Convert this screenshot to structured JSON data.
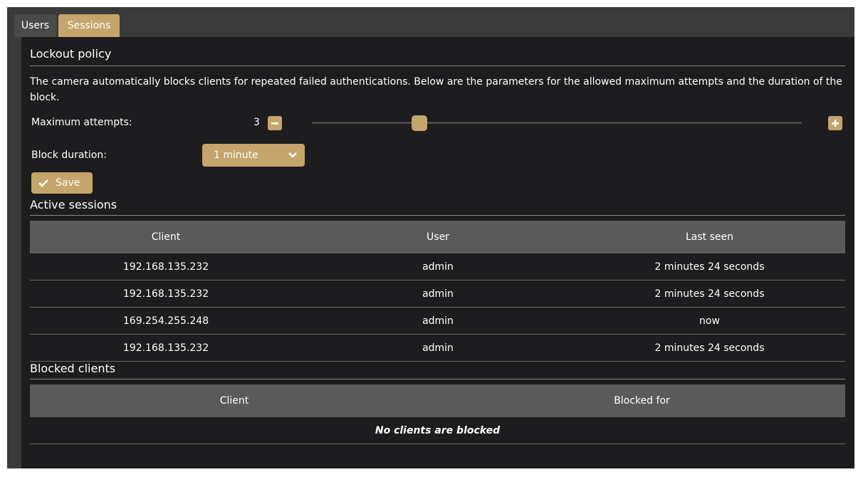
{
  "tabs": [
    {
      "label": "Users",
      "active": false
    },
    {
      "label": "Sessions",
      "active": true
    }
  ],
  "lockout": {
    "title": "Lockout policy",
    "description": "The camera automatically blocks clients for repeated failed authentications. Below are the parameters for the allowed maximum attempts and the duration of the block.",
    "max_attempts_label": "Maximum attempts:",
    "max_attempts_value": "3",
    "slider_fraction": 0.22,
    "block_duration_label": "Block duration:",
    "block_duration_value": "1 minute",
    "save_label": "Save"
  },
  "active_sessions": {
    "title": "Active sessions",
    "columns": [
      "Client",
      "User",
      "Last seen"
    ],
    "rows": [
      [
        "192.168.135.232",
        "admin",
        "2 minutes 24 seconds"
      ],
      [
        "192.168.135.232",
        "admin",
        "2 minutes 24 seconds"
      ],
      [
        "169.254.255.248",
        "admin",
        "now"
      ],
      [
        "192.168.135.232",
        "admin",
        "2 minutes 24 seconds"
      ]
    ]
  },
  "blocked_clients": {
    "title": "Blocked clients",
    "columns": [
      "Client",
      "Blocked for"
    ],
    "empty_text": "No clients are blocked"
  },
  "colors": {
    "accent": "#c4a56b",
    "panel": "#1d1d1f",
    "frame": "#3b3b3b",
    "header": "#5a5a5a"
  }
}
